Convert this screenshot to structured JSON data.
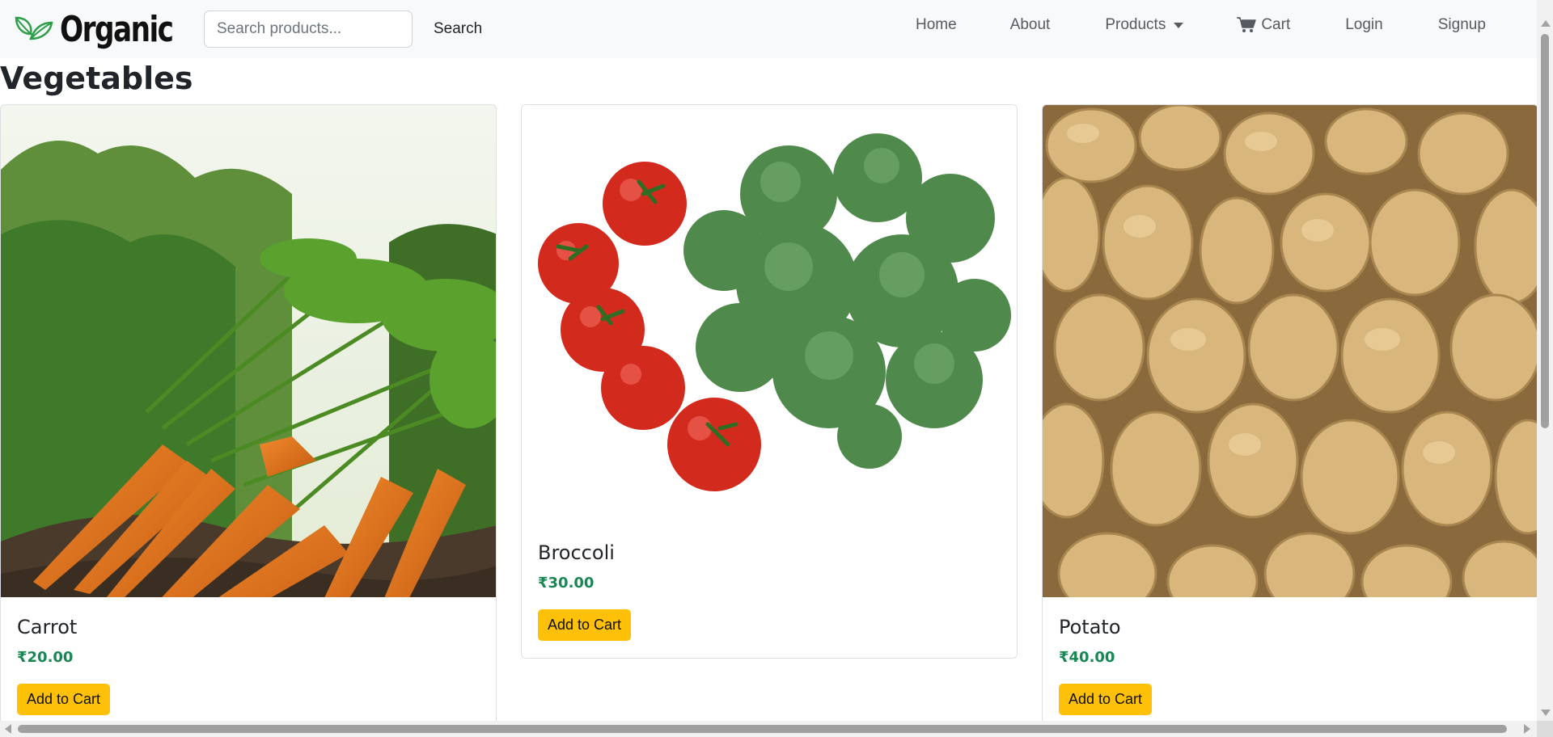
{
  "brand": {
    "name": "Organic",
    "logo_icon": "leaf-icon",
    "logo_color": "#2e9e4a"
  },
  "search": {
    "placeholder": "Search products...",
    "value": "",
    "button_label": "Search"
  },
  "nav": {
    "home": "Home",
    "about": "About",
    "products": "Products",
    "cart": "Cart",
    "login": "Login",
    "signup": "Signup"
  },
  "page": {
    "title": "Vegetables"
  },
  "products": [
    {
      "name": "Carrot",
      "price": "₹20.00",
      "button_label": "Add to Cart",
      "image": "carrot-photo"
    },
    {
      "name": "Broccoli",
      "price": "₹30.00",
      "button_label": "Add to Cart",
      "image": "broccoli-tomato-photo"
    },
    {
      "name": "Potato",
      "price": "₹40.00",
      "button_label": "Add to Cart",
      "image": "potato-photo"
    }
  ],
  "colors": {
    "navbar_bg": "#f8f9fa",
    "price_green": "#198754",
    "button_yellow": "#ffc107",
    "text_dark": "#212529"
  }
}
